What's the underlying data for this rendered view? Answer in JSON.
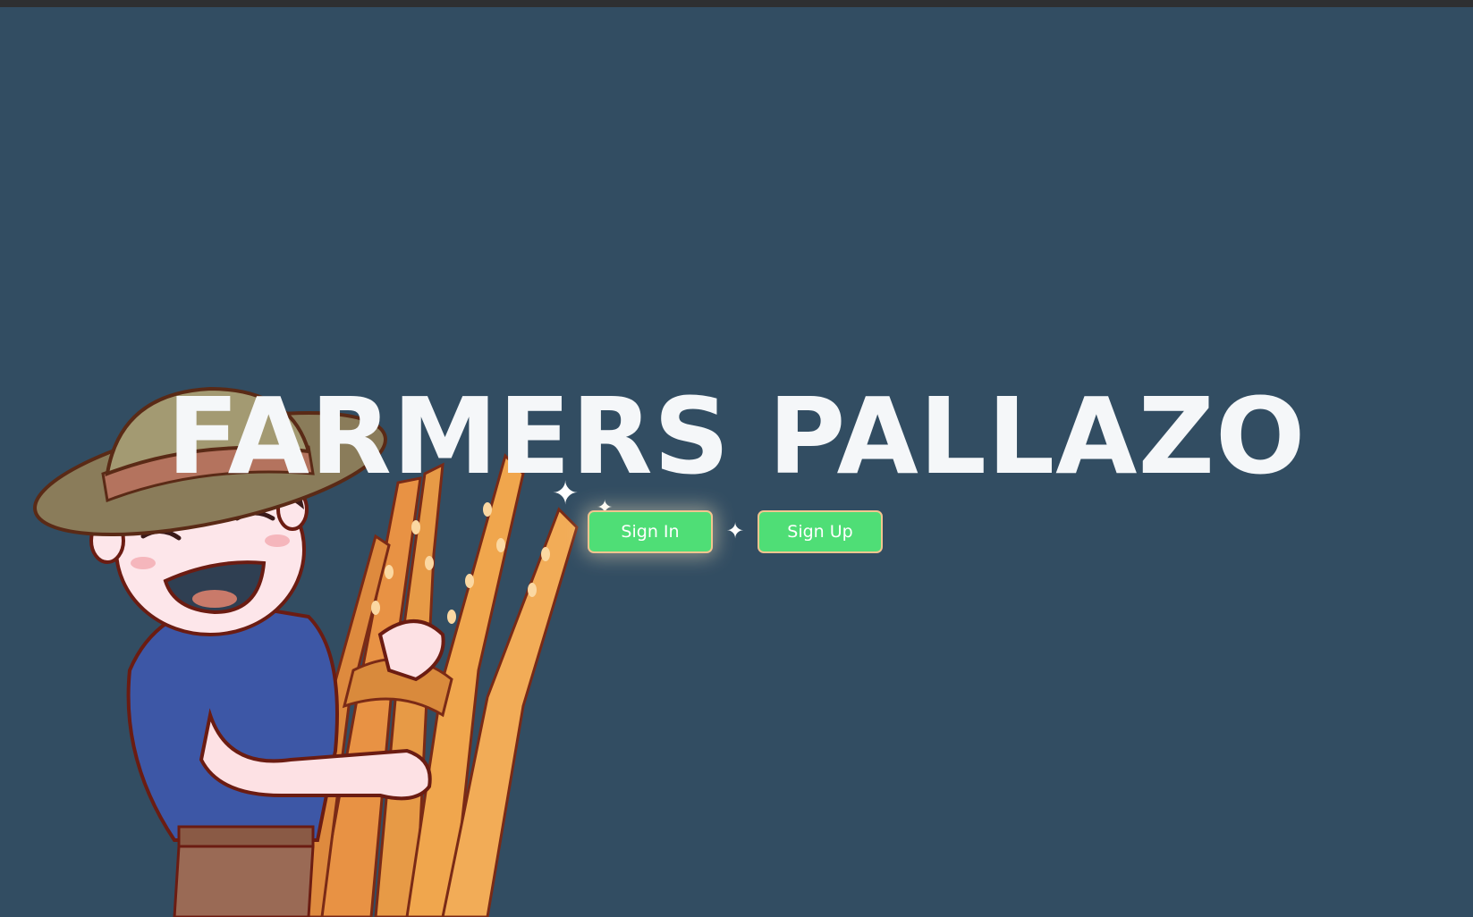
{
  "hero": {
    "title": "FARMERS PALLAZO"
  },
  "auth": {
    "signin_label": "Sign In",
    "signup_label": "Sign Up"
  },
  "colors": {
    "background": "#324d62",
    "button": "#4fde76",
    "button_border": "#f2c58f",
    "title": "#f5f7f9"
  },
  "icons": {
    "sparkle": "sparkle-icon",
    "illustration": "farmer-with-wheat-illustration"
  }
}
